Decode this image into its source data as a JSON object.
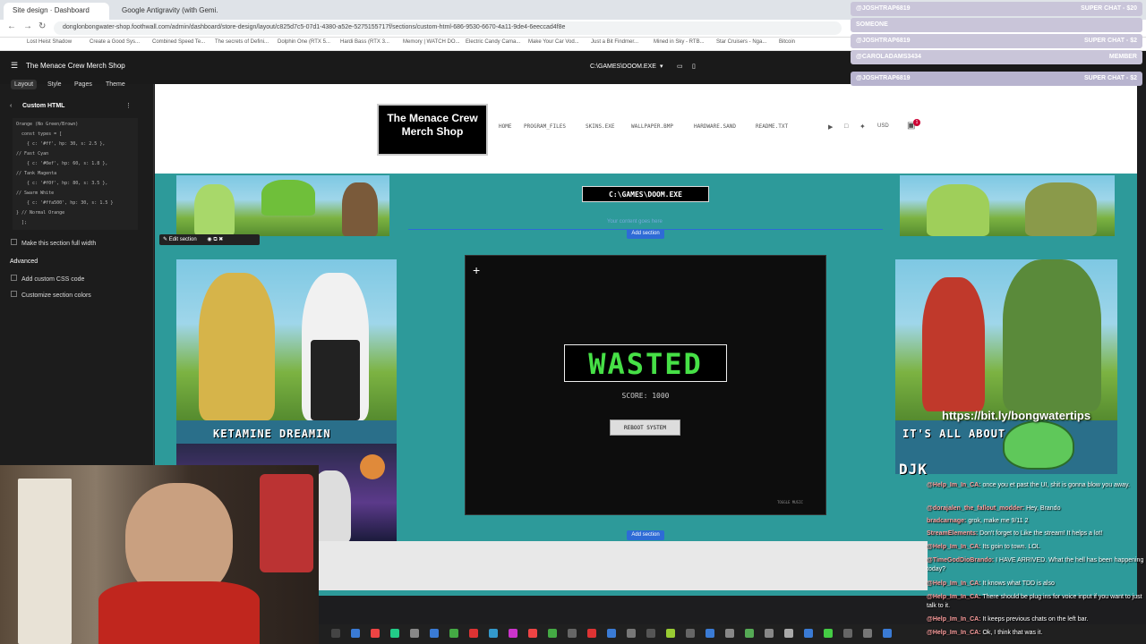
{
  "browser": {
    "tabs": [
      {
        "label": "Site design · Dashboard",
        "active": true
      },
      {
        "label": "Google Antigravity (with Gemi...",
        "active": false
      }
    ],
    "url": "donglonbongwater-shop.foothwall.com/admin/dashboard/store-design/layout/c825d7c5-07d1-4380-a52e-5275155717f/sections/custom-html-686-9530-6670-4a11-9de4-6eeccad4f8e",
    "bookmarks": [
      "Lost Heist Shadow",
      "Create a Good Sys...",
      "Combined Speed Te...",
      "The secrets of Defini...",
      "Dolphin One (RTX 5...",
      "Hardi Bass (RTX 3...",
      "Memory | WATCH DO...",
      "Electric Candy Cama...",
      "Make Your Car Vod...",
      "Just a Bit Findmer...",
      "Mined in Sky - RTB...",
      "Star Cruisers - Nga...",
      "Bitcoin"
    ]
  },
  "editor": {
    "shop_name": "The Menace Crew Merch Shop",
    "tabs": [
      "Layout",
      "Style",
      "Pages",
      "Theme"
    ],
    "device_selector": "C:\\GAMES\\DOOM.EXE",
    "section_title": "Custom HTML",
    "code_lines": [
      "Orange (No Green/Brown)",
      "  const types = [",
      "    { c: '#ff', hp: 30, s: 2.5 },",
      "// Fast Cyan",
      "    { c: '#0ef', hp: 60, s: 1.8 },",
      "// Tank Magenta",
      "    { c: '#f0f', hp: 80, s: 3.5 },",
      "// Swarm White",
      "    { c: '#ffa500', hp: 30, s: 1.5 }",
      "} // Normal Orange",
      "  ];"
    ],
    "full_width_label": "Make this section full width",
    "advanced_label": "Advanced",
    "custom_css_label": "Add custom CSS code",
    "customize_colors_label": "Customize section colors"
  },
  "store": {
    "logo_text": "The Menace Crew Merch Shop",
    "nav": [
      "HOME",
      "PROGRAM_FILES",
      "SKINS.EXE",
      "WALLPAPER.BMP",
      "HARDWARE.SAND",
      "README.TXT"
    ],
    "currency": "USD",
    "cart_count": "1",
    "game_title": "C:\\GAMES\\DOOM.EXE",
    "placeholder_text": "Your content goes here",
    "edit_section_label": "Edit section",
    "add_section_label": "Add section",
    "wasted_text": "WASTED",
    "score_text": "SCORE: 1000",
    "reboot_label": "REBOOT SYSTEM",
    "toggle_music": "TOGGLE MUSIC",
    "left_caption": "KETAMINE DREAMIN",
    "right_caption": "IT'S ALL ABOUT ... DAY",
    "right_caption_2": "DJK"
  },
  "stream": {
    "alerts": [
      {
        "user": "@JOSHTRAP6819",
        "label": "SUPER CHAT - $20"
      },
      {
        "user": "SOMEONE",
        "label": ""
      },
      {
        "user": "@JOSHTRAP6819",
        "label": "SUPER CHAT - $2"
      },
      {
        "user": "@CAROLADAMS3434",
        "label": "MEMBER"
      },
      {
        "user": "@JOSHTRAP6819",
        "label": "SUPER CHAT - $2"
      }
    ],
    "promo_url": "https://bit.ly/bongwatertips",
    "chat": [
      {
        "user": "@Help_Im_In_CA:",
        "msg": "once you et past the UI, shit is gonna blow you away."
      },
      {
        "user": "@dorajalen_the_fallout_modder:",
        "msg": "Hey, Brando"
      },
      {
        "user": "bradcarnage:",
        "msg": "grok, make me 9/11 2"
      },
      {
        "user": "StreamElements:",
        "msg": "Don't forget to Like the stream! It helps a lot!"
      },
      {
        "user": "@Help_Im_In_CA:",
        "msg": "Its goin to town. LOL"
      },
      {
        "user": "@TimeGodDioBrando:",
        "msg": "I HAVE ARRIVED. What the hell has been happening today?"
      },
      {
        "user": "@Help_Im_In_CA:",
        "msg": "It knows what TDD is also"
      },
      {
        "user": "@Help_Im_In_CA:",
        "msg": "There should be plug ins for voice input if you want to just talk to it."
      },
      {
        "user": "@Help_Im_In_CA:",
        "msg": "It keeps previous chats on the left bar."
      },
      {
        "user": "@Help_Im_In_CA:",
        "msg": "Ok, I think that was it."
      }
    ]
  },
  "colors": {
    "accent_blue": "#2e6bd6",
    "preview_bg": "#2d9a9a",
    "wasted_green": "#46e046"
  }
}
